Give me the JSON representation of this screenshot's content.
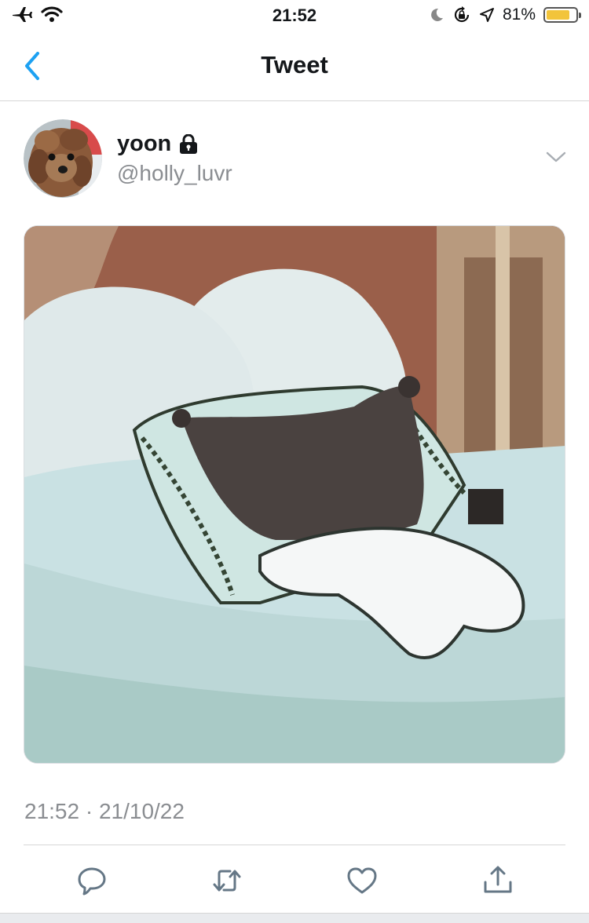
{
  "status_bar": {
    "time": "21:52",
    "battery_percent": "81%",
    "battery_level": 0.81,
    "icons": [
      "airplane-icon",
      "wifi-icon",
      "moon-icon",
      "orientation-lock-icon",
      "location-arrow-icon",
      "battery-icon"
    ]
  },
  "nav": {
    "title": "Tweet",
    "back_icon": "chevron-left-icon",
    "accent_color": "#1da1f2"
  },
  "tweet": {
    "author_name": "yoon",
    "author_handle": "@holly_luvr",
    "protected_icon": "lock-icon",
    "more_icon": "chevron-down-icon",
    "timestamp": "21:52 · 21/10/22"
  },
  "actions": {
    "icons": [
      "reply-icon",
      "retweet-icon",
      "like-icon",
      "share-icon"
    ],
    "icon_color": "#657786"
  }
}
